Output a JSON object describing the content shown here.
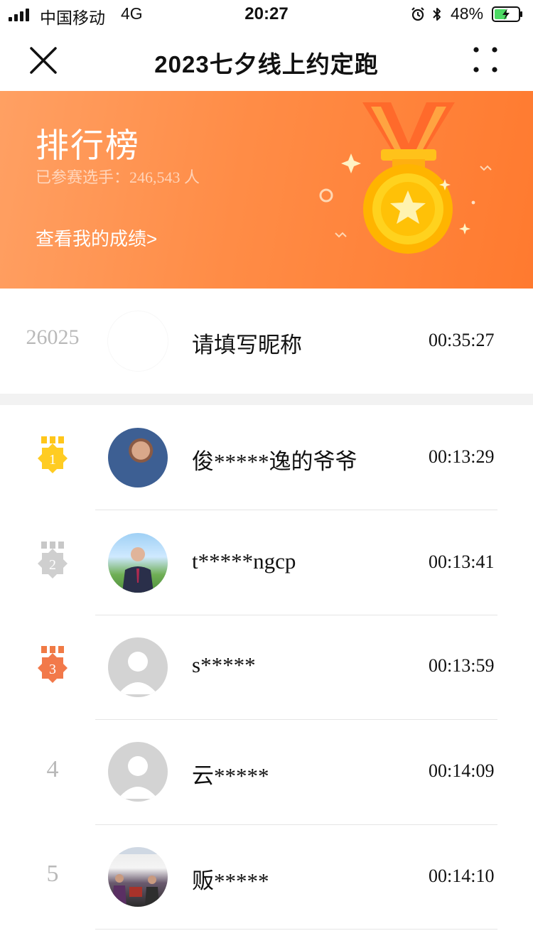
{
  "status_bar": {
    "carrier": "中国移动",
    "network": "4G",
    "time": "20:27",
    "battery_percent": "48%"
  },
  "nav": {
    "title": "2023七夕线上约定跑",
    "close_icon": "close-icon",
    "more_icon": "more-dots-icon"
  },
  "banner": {
    "title": "排行榜",
    "participants": "已参赛选手：246,543 人",
    "my_score_link": "查看我的成绩>",
    "colors": {
      "start": "#ffa063",
      "end": "#ff7a2f"
    }
  },
  "my_entry": {
    "rank": "26025",
    "name": "请填写昵称",
    "time": "00:35:27"
  },
  "leaderboard": [
    {
      "rank": "1",
      "name": "俊*****逸的爷爷",
      "time": "00:13:29",
      "medal": "gold",
      "avatar": "photo"
    },
    {
      "rank": "2",
      "name": "t*****ngcp",
      "time": "00:13:41",
      "medal": "silver",
      "avatar": "photo"
    },
    {
      "rank": "3",
      "name": "s*****",
      "time": "00:13:59",
      "medal": "bronze",
      "avatar": "default"
    },
    {
      "rank": "4",
      "name": "云*****",
      "time": "00:14:09",
      "medal": "none",
      "avatar": "default"
    },
    {
      "rank": "5",
      "name": "贩*****",
      "time": "00:14:10",
      "medal": "none",
      "avatar": "photo"
    }
  ]
}
